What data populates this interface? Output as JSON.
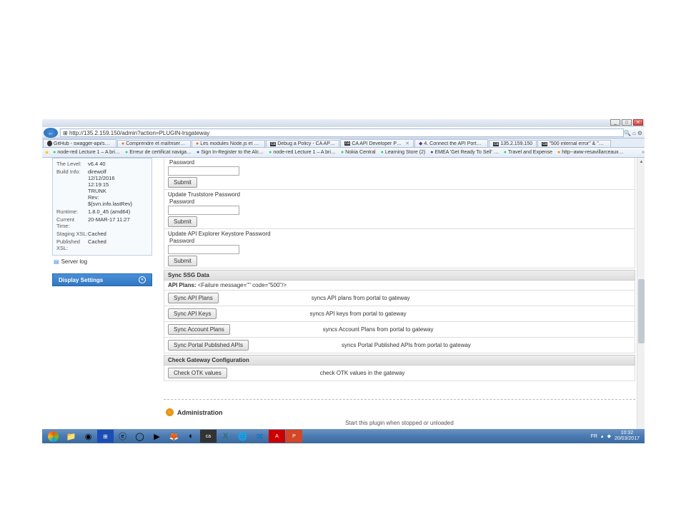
{
  "window": {
    "min": "_",
    "max": "□",
    "close": "✕"
  },
  "address": {
    "back": "←",
    "url": "http://135.2.159.150/admin?action=PLUGIN-lrsgateway",
    "search_icon": "🔍",
    "home": "⌂",
    "gear": "⚙"
  },
  "tabs": [
    {
      "label": "GitHub - swagger-api/swagg…",
      "favicon": "github"
    },
    {
      "label": "Comprendre et maîtriser npm…",
      "favicon": "orange"
    },
    {
      "label": "Les modules Node.js et NPM …",
      "favicon": "orange"
    },
    {
      "label": "Debug a Policy - CA API Gate…",
      "favicon": "ca"
    },
    {
      "label": "CA API Developer Portal: P…",
      "favicon": "ca",
      "closable": true
    },
    {
      "label": "4. Connect the API Portal to t…",
      "favicon": "purple"
    },
    {
      "label": "135.2.159.150",
      "favicon": "ca"
    },
    {
      "label": "\"500 internal error\" & \"Asserti…",
      "favicon": "ca"
    }
  ],
  "bookmarks": [
    {
      "label": "node-red Lecture 1 – A bri…",
      "icon": "green"
    },
    {
      "label": "Erreur de certificat  naviga…",
      "icon": "green"
    },
    {
      "label": "Sign In-Register to the Alc…",
      "icon": "blue"
    },
    {
      "label": "node-red Lecture 1 – A bri…",
      "icon": "green"
    },
    {
      "label": "Nokia Central",
      "icon": "green"
    },
    {
      "label": "Learning Store (2)",
      "icon": "green"
    },
    {
      "label": "EMEA 'Get Ready To Sell' …",
      "icon": "purple"
    },
    {
      "label": "Travel and Expense",
      "icon": "green"
    },
    {
      "label": "http--aww-resavillarceaux…",
      "icon": "orange"
    }
  ],
  "sidebar": {
    "rows": [
      {
        "label": "The Level:",
        "value": "v6.4 40"
      },
      {
        "label": "Build Info:",
        "value": "direwolf\n12/12/2016\n12:19:15\nTRUNK\nRev:\n${svn.info.lastRev}"
      },
      {
        "label": "Runtime:",
        "value": "1.8.0_45 (amd64)"
      },
      {
        "label": "Current Time:",
        "value": "20-MAR-17 11:27"
      },
      {
        "label": "Staging XSL:",
        "value": "Cached"
      },
      {
        "label": "Published XSL:",
        "value": "Cached"
      }
    ],
    "server_log": "Server log",
    "display_settings": "Display Settings"
  },
  "main": {
    "top_password": "Password",
    "submit": "Submit",
    "truststore_title": "Update Truststore Password",
    "truststore_pw": "Password",
    "apiexp_title": "Update API Explorer Keystore Password",
    "apiexp_pw": "Password",
    "sync_header": "Sync SSG Data",
    "api_plans_status": "API Plans: <Failure message=\"\" code=\"500\"/>",
    "sync_rows": [
      {
        "btn": "Sync API Plans",
        "desc": "syncs API plans from portal to gateway"
      },
      {
        "btn": "Sync API Keys",
        "desc": "syncs API keys from portal to gateway"
      },
      {
        "btn": "Sync Account Plans",
        "desc": "syncs Account Plans from portal to gateway"
      },
      {
        "btn": "Sync Portal Published APIs",
        "desc": "syncs Portal Published APIs from portal to gateway"
      }
    ],
    "check_header": "Check Gateway Configuration",
    "check_btn": "Check OTK values",
    "check_desc": "check OTK values in the gateway",
    "admin": "Administration",
    "sub_note": "Start this plugin when stopped or unloaded"
  },
  "taskbar": {
    "lang": "FR",
    "time": "10:32",
    "date": "20/03/2017"
  }
}
